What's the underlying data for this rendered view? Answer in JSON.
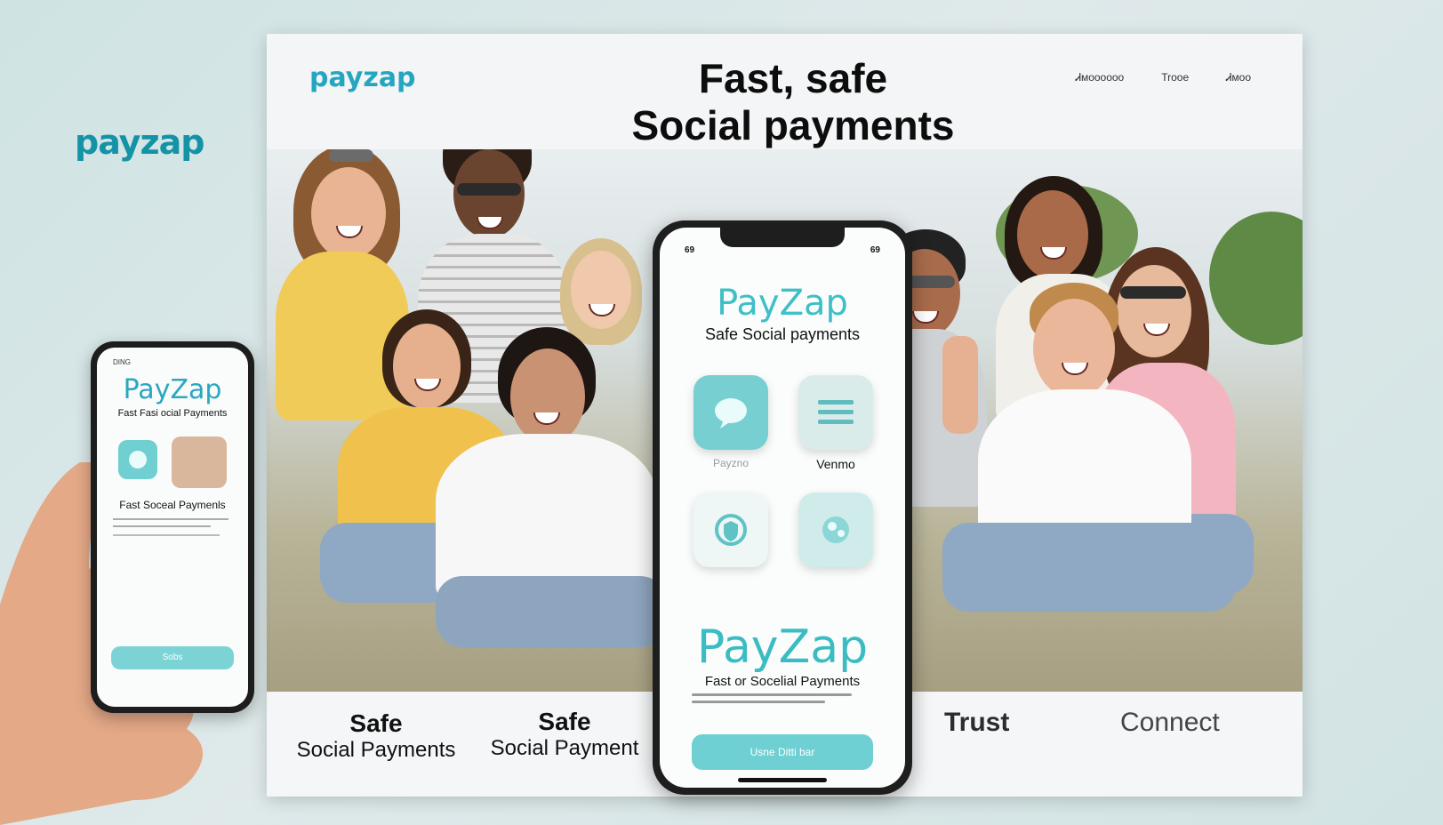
{
  "outside_brand": "payzap",
  "page": {
    "logo": "payzap",
    "headline_line1": "Fast, safe",
    "headline_line2": "Social payments",
    "nav": [
      "Ꮧᴍᴏᴏᴏᴏᴏᴏ",
      "Trooe",
      "Ꮧᴍᴏᴏ"
    ]
  },
  "strip": {
    "item1_line1": "Safe",
    "item1_line2": "Social Payments",
    "item2_line1": "Safe",
    "item2_line2": "Social Payment",
    "trust": "Trust",
    "connect": "Connect"
  },
  "center_phone": {
    "status_left": "69",
    "status_right": "69",
    "title": "PayZap",
    "subtitle": "Safe Social payments",
    "tile_labels": [
      "Payzno",
      "Venmo"
    ],
    "big_title": "PayZap",
    "big_subtitle": "Fast or Socelial Payments",
    "cta": "Usne Ditti bar"
  },
  "left_phone": {
    "status": "DING",
    "title": "PayZap",
    "subtitle": "Fast Fasi ocial Payments",
    "mid_text": "Fast Soceal Paymenls",
    "cta": "Sobs"
  },
  "colors": {
    "accent": "#3fbfc6",
    "brand_blue": "#1493a7"
  },
  "icons": [
    "chat-bubble-icon",
    "menu-lines-icon",
    "shield-icon",
    "globe-icon"
  ]
}
